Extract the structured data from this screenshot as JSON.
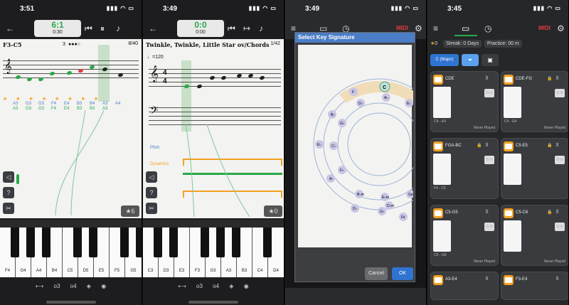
{
  "panel1": {
    "time": "3:51",
    "counter_main": "6:1",
    "counter_sub": "0:30",
    "header": "F3-C5",
    "page": "8/40",
    "measure": "3",
    "labels_top": [
      "A3",
      "G3",
      "G3",
      "F4",
      "E4",
      "B3",
      "B4",
      "A3",
      "A4"
    ],
    "labels_bottom": [
      "A3",
      "G3",
      "G3",
      "F4",
      "E4",
      "B3",
      "B3",
      "A3"
    ],
    "key_labels": [
      "F4",
      "G4",
      "A4",
      "B4",
      "C5",
      "D5",
      "E5",
      "F5",
      "G5"
    ],
    "score_badge": "6",
    "bottom": [
      "o3",
      "o4"
    ]
  },
  "panel2": {
    "time": "3:49",
    "counter_main": "0:0",
    "counter_sub": "0:00",
    "header": "Twinkle, Twinkle, Little Star ov/Chords",
    "page": "1/42",
    "tempo": "=120",
    "pitch_label": "Pitch",
    "dynamics_label": "Dynamics",
    "key_labels": [
      "C3",
      "D3",
      "E3",
      "F3",
      "G3",
      "A3",
      "B3",
      "C4",
      "D4"
    ],
    "score_badge": "0",
    "bottom": [
      "o3",
      "o4"
    ]
  },
  "panel3": {
    "time": "3:49",
    "midi": "MIDI",
    "dialog_title": "Select Key Signature",
    "center_key": "C",
    "cancel": "Cancel",
    "ok": "OK"
  },
  "panel4": {
    "time": "3:45",
    "midi": "MIDI",
    "stars": "0",
    "streak": "Streak: 0 Days",
    "practice": "Practice: 00 m",
    "filter_key": "C (Major)",
    "cards": [
      {
        "name": "CDE",
        "range": "C4 - E4",
        "status": "Never Played",
        "locked": false
      },
      {
        "name": "CDE-FG",
        "range": "C4 - G4",
        "status": "Never Played",
        "locked": true
      },
      {
        "name": "FGA-BC",
        "range": "F4 - C5",
        "status": "",
        "locked": true
      },
      {
        "name": "C5-E5",
        "range": "",
        "status": "",
        "locked": true
      },
      {
        "name": "C5-G5",
        "range": "C5 - G5",
        "status": "Never Played",
        "locked": false
      },
      {
        "name": "C5-C6",
        "range": "",
        "status": "Never Played",
        "locked": true
      },
      {
        "name": "A3-E4",
        "range": "",
        "status": "",
        "locked": false
      },
      {
        "name": "F3-E4",
        "range": "",
        "status": "",
        "locked": false
      }
    ]
  },
  "colors": {
    "green": "#29a84a",
    "blue": "#4a7dc6",
    "orange": "#f4a021",
    "gray": "#3a3b3e"
  }
}
